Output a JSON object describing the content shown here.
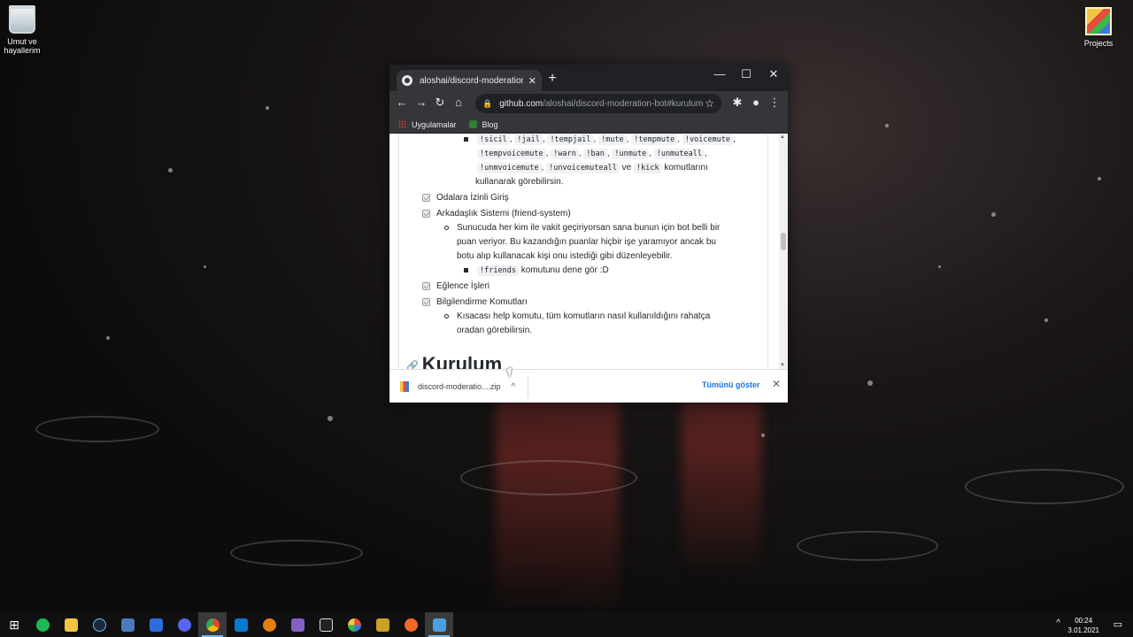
{
  "desktop": {
    "icons": [
      {
        "label_line1": "Umut ve",
        "label_line2": "hayallerim",
        "icon": "recycle-bin-icon"
      },
      {
        "label_line1": "Projects",
        "label_line2": "",
        "icon": "winrar-folder-icon"
      }
    ]
  },
  "browser": {
    "tab_title": "aloshai/discord-moderation-bot",
    "tab_close": "✕",
    "new_tab": "+",
    "controls": {
      "minimize": "—",
      "maximize": "☐",
      "close": "✕"
    },
    "nav": {
      "back": "←",
      "forward": "→",
      "reload": "↻",
      "home": "⌂"
    },
    "url_host": "github.com",
    "url_path": "/aloshai/discord-moderation-bot#kurulum",
    "bookmarks": [
      "Uygulamalar",
      "Blog"
    ]
  },
  "readme": {
    "commands_line1": [
      "!sicil",
      "!jail",
      "!tempjail",
      "!mute",
      "!tempmute",
      "!voicemute"
    ],
    "commands_line2": [
      "!tempvoicemute",
      "!warn",
      "!ban",
      "!unmute",
      "!unmuteall"
    ],
    "commands_line3": [
      "!unmvoicemute",
      "!unvoicemuteall"
    ],
    "ve_text": "ve",
    "kick_cmd": "!kick",
    "kick_tail": "komutlarını",
    "kullanarak": "kullanarak görebilirsin.",
    "item_odalar": "Odalara İzinli Giriş",
    "item_arkadas": "Arkadaşlık Sistemi (friend-system)",
    "arkadas_desc1": "Sunucuda her kim ile vakit geçiriyorsan sana bunun için bot belli bir",
    "arkadas_desc2": "puan veriyor. Bu kazandığın puanlar hiçbir işe yaramıyor ancak bu",
    "arkadas_desc3": "botu alıp kullanacak kişi onu istediği gibi düzenleyebilir.",
    "friends_cmd": "!friends",
    "friends_tail": "komutunu dene gör :D",
    "item_eglence": "Eğlence İşleri",
    "item_bilgi": "Bilgilendirme Komutları",
    "bilgi_desc1": "Kısacası help komutu, tüm komutların nasıl kullanıldığını rahatça",
    "bilgi_desc2": "oradan görebilirsin.",
    "heading": "Kurulum"
  },
  "download_bar": {
    "file_name": "discord-moderatio....zip",
    "show_all": "Tümünü göster"
  },
  "taskbar": {
    "time": "00:24",
    "date": "3.01.2021",
    "apps": [
      "start-icon",
      "spotify-icon",
      "file-explorer-icon",
      "steam-icon",
      "calculator-icon",
      "app-icon",
      "discord-icon",
      "chrome-icon",
      "vscode-icon",
      "blender-icon",
      "visual-studio-icon",
      "unity-icon",
      "photo-icon",
      "app-icon-2",
      "app-icon-3",
      "app-icon-4"
    ]
  }
}
